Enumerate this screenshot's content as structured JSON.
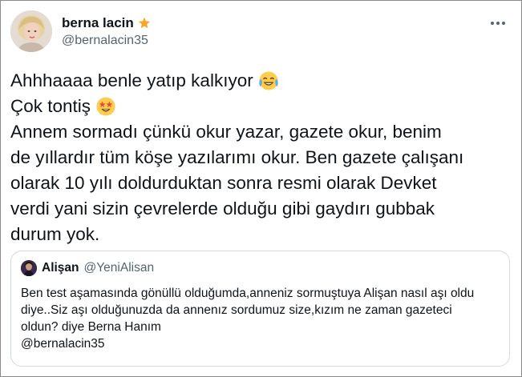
{
  "author": {
    "display_name": "berna lacin",
    "badge_icon": "star-icon",
    "handle": "@bernalacin35"
  },
  "tweet": {
    "lines": [
      "Ahhhaaaa benle yatıp kalkıyor",
      "Çok tontiş",
      "Annem sormadı çünkü okur yazar, gazete okur, benim",
      "de yıllardır tüm köşe yazılarımı okur. Ben gazete çalışanı",
      "olarak 10 yılı doldurduktan sonra resmi olarak Devket",
      "verdi yani sizin çevrelerde olduğu gibi gaydırı gubbak",
      "durum yok."
    ],
    "emojis": [
      "laughing-tears-emoji",
      "star-eyes-emoji"
    ]
  },
  "quoted_tweet": {
    "display_name": "Alişan",
    "handle": "@YeniAlisan",
    "lines": [
      "Ben test aşamasında gönüllü olduğumda,anneniz sormuştuya Alişan nasıl aşı oldu",
      "diye..Siz aşı olduğunuzda da annenız sordumuz size,kızım ne zaman gazeteci",
      "oldun? diye Berna Hanım",
      "@bernalacin35"
    ]
  },
  "colors": {
    "text": "#0f1419",
    "secondary": "#536471",
    "border": "#cfd9de",
    "star": "#f6a623",
    "emoji_yellow": "#ffcc4d"
  }
}
